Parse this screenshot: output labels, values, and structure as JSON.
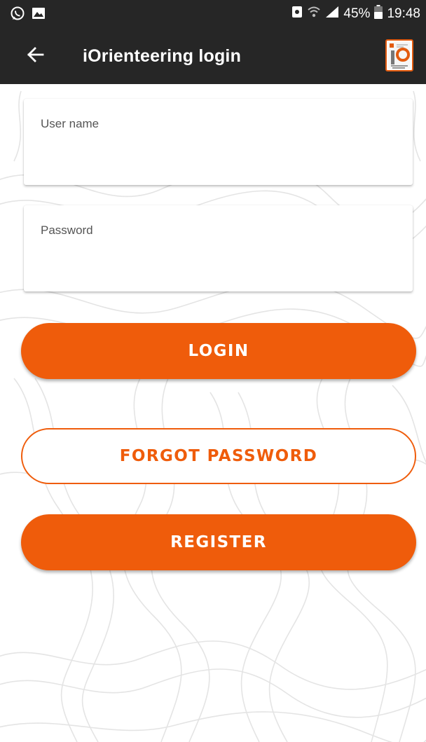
{
  "status_bar": {
    "battery": "45%",
    "time": "19:48",
    "icons": [
      "whatsapp-icon",
      "image-icon",
      "notification-icon",
      "wifi-icon",
      "signal-icon",
      "battery-icon"
    ]
  },
  "app_bar": {
    "title": "iOrienteering login",
    "back_icon": "arrow-left-icon",
    "logo_icon": "app-logo-icon"
  },
  "form": {
    "username_label": "User name",
    "username_value": "",
    "password_label": "Password",
    "password_value": ""
  },
  "buttons": {
    "login": "LOGIN",
    "forgot_password": "FORGOT PASSWORD",
    "register": "REGISTER"
  },
  "colors": {
    "accent": "#ef5c0b",
    "app_bar": "#262626",
    "background": "#ffffff",
    "topo_lines": "#e4e4e4"
  }
}
